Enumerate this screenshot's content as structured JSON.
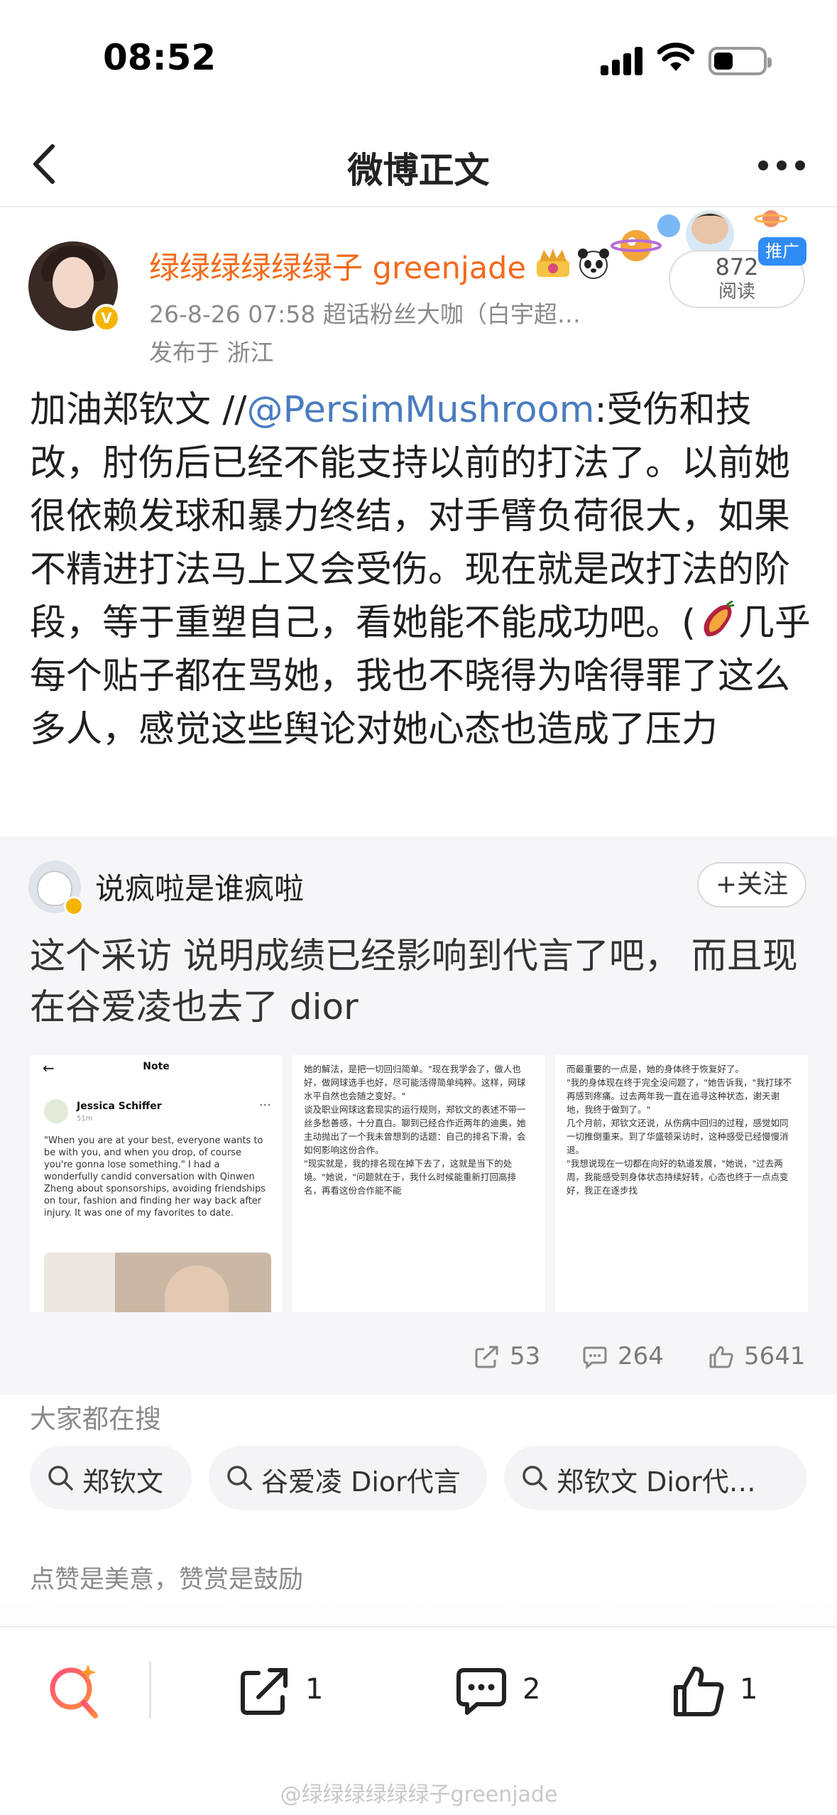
{
  "status_bar": {
    "time": "08:52"
  },
  "nav": {
    "title": "微博正文"
  },
  "post": {
    "username": "绿绿绿绿绿绿子 greenjade",
    "meta": "26-8-26 07:58  超话粉丝大咖（白宇超…",
    "location": "发布于 浙江",
    "read_count": "872",
    "read_label": "阅读",
    "promo_tag": "推广",
    "body_prefix": "加油郑钦文 //",
    "mention": "@PersimMushroom",
    "body_1": ":受伤和技改，肘伤后已经不能支持以前的打法了。以前她很依赖发球和暴力终结，对手臂负荷很大，如果不精进打法马上又会受伤。现在就是改打法的阶段，等于重塑自己，看她能不能成功吧。(",
    "body_2": "几乎每个贴子都在骂她，我也不晓得为啥得罪了这么多人，感觉这些舆论对她心态也造成了压力"
  },
  "repost": {
    "username": "说疯啦是谁疯啦",
    "follow_label": "+关注",
    "text": "这个采访 说明成绩已经影响到代言了吧， 而且现在谷爱凌也去了 dior",
    "thumb1": {
      "header": "Note",
      "back": "←",
      "author": "Jessica Schiffer",
      "time": "51m",
      "dots": "···",
      "quote": "\"When you are at your best, everyone wants to be with you, and when you drop, of course you're gonna lose something.\" I had a wonderfully candid conversation with Qinwen Zheng about sponsorships, avoiding friendships on tour, fashion and finding her way back after injury. It was one of my favorites to date."
    },
    "thumb2": {
      "text": "她的解法，是把一切回归简单。\"现在我学会了，做人也好，做网球选手也好，尽可能活得简单纯粹。这样，网球水平自然也会随之变好。\"\n谈及职业网球这套现实的运行规则，郑钦文的表述不带一丝多愁善感，十分直白。聊到已经合作近两年的迪奥，她主动抛出了一个我未曾想到的话题：自己的排名下滑，会如何影响这份合作。\n\"现实就是，我的排名现在掉下去了，这就是当下的处境。\"她说，\"问题就在于，我什么时候能重新打回高排名，再看这份合作能不能"
    },
    "thumb3": {
      "text": "而最重要的一点是，她的身体终于恢复好了。\n\"我的身体现在终于完全没问题了，\"她告诉我，\"我打球不再感到疼痛。过去两年我一直在追寻这种状态，谢天谢地，我终于做到了。\"\n几个月前，郑钦文还说，从伤病中回归的过程，感觉如同一切推倒重来。到了华盛顿采访时，这种感受已经慢慢消退。\n\"我想说现在一切都在向好的轨道发展，\"她说，\"过去两周，我能感受到身体状态持续好转，心态也终于一点点变好，我正在逐步找"
    },
    "shares": "53",
    "comments": "264",
    "likes": "5641"
  },
  "search": {
    "title": "大家都在搜",
    "chips": [
      "郑钦文",
      "谷爱凌 Dior代言",
      "郑钦文 Dior代…"
    ]
  },
  "reward_note": "点赞是美意，赞赏是鼓励",
  "bottom_bar": {
    "shares": "1",
    "comments": "2",
    "likes": "1",
    "watermark": "@绿绿绿绿绿绿子greenjade"
  },
  "colors": {
    "username": "#f26a1b",
    "mention": "#4a7cbf",
    "promo": "#2f8cf4",
    "verified": "#f5b400"
  },
  "icons": [
    "back-arrow-icon",
    "more-dots-icon",
    "verified-icon",
    "crown-badge-icon",
    "panda-badge-icon",
    "sweet-potato-emoji-icon",
    "share-icon",
    "comment-icon",
    "like-icon",
    "search-icon",
    "weibo-search-icon"
  ]
}
